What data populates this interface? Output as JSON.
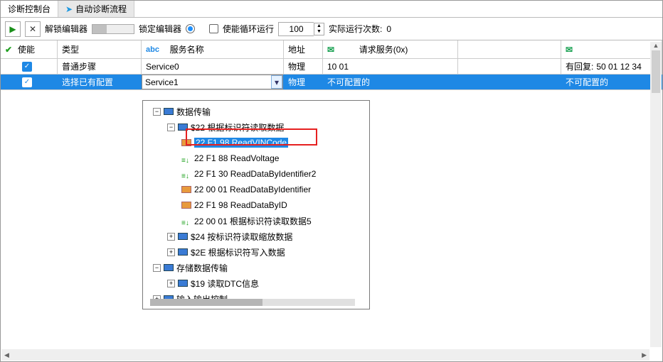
{
  "tabs": {
    "console": "诊断控制台",
    "flow": "自动诊断流程"
  },
  "toolbar": {
    "unlock": "解锁编辑器",
    "lock": "锁定编辑器",
    "loop": "使能循环运行",
    "loop_count": "100",
    "run_count_label": "实际运行次数:",
    "run_count": "0"
  },
  "headers": {
    "enable": "使能",
    "type": "类型",
    "service_name": "服务名称",
    "address": "地址",
    "request": "请求服务(0x)"
  },
  "rows": {
    "r1": {
      "type": "普通步骤",
      "service": "Service0",
      "addr": "物理",
      "req": "10 01",
      "resp_label": "有回复:",
      "resp": "50 01 12 34"
    },
    "r2": {
      "type": "选择已有配置",
      "service": "Service1",
      "addr": "物理",
      "req": "不可配置的",
      "resp": "不可配置的"
    }
  },
  "tree": {
    "n1": "数据传输",
    "n2": "$22 根据标识符读取数据",
    "n3": "22 F1 98 ReadVINCode",
    "n4": "22 F1 88 ReadVoltage",
    "n5": "22 F1 30 ReadDataByIdentifier2",
    "n6": "22 00 01 ReadDataByIdentifier",
    "n7": "22 F1 98 ReadDataByID",
    "n8": "22 00 01 根据标识符读取数据5",
    "n9": "$24 按标识符读取缩放数据",
    "n10": "$2E 根据标识符写入数据",
    "n11": "存储数据传输",
    "n12": "$19 读取DTC信息",
    "n13": "输入输出控制"
  }
}
